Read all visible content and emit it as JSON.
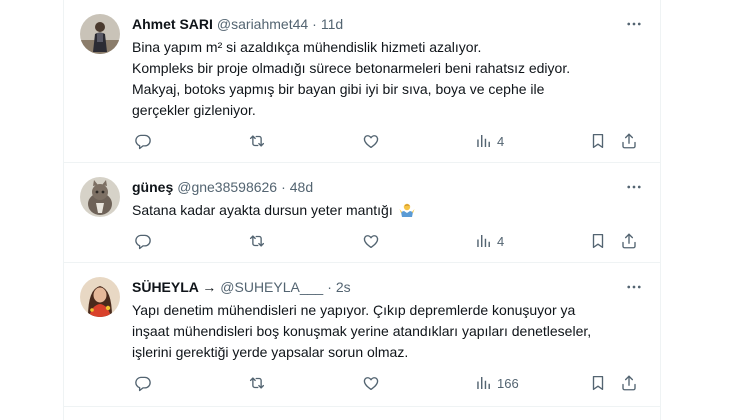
{
  "tweets": [
    {
      "display_name": "Ahmet SARI",
      "handle": "@sariahmet44",
      "separator": "·",
      "time": "11d",
      "lines": [
        "Bina yapım m² si azaldıkça mühendislik hizmeti azalıyor.",
        "Kompleks bir proje olmadığı sürece betonarmeleri beni rahatsız ediyor.",
        "Makyaj, botoks yapmış bir bayan gibi iyi bir sıva, boya ve cephe ile",
        "gerçekler gizleniyor."
      ],
      "views": "4"
    },
    {
      "display_name": "güneş",
      "handle": "@gne38598626",
      "separator": "·",
      "time": "48d",
      "lines": [
        "Satana kadar ayakta dursun yeter mantığı"
      ],
      "views": "4"
    },
    {
      "display_name": "SÜHEYLA →",
      "handle": "@SUHEYLA___",
      "separator": "·",
      "time": "2s",
      "lines": [
        "Yapı denetim mühendisleri ne yapıyor. Çıkıp depremlerde konuşuyor ya",
        "inşaat mühendisleri boş konuşmak yerine atandıkları yapıları denetleseler,",
        "işlerini gerektiği yerde yapsalar sorun olmaz."
      ],
      "views": "166"
    }
  ],
  "colors": {
    "text": "#0f1419",
    "muted": "#536471",
    "border": "#eff3f4"
  },
  "icons": [
    "reply-icon",
    "retweet-icon",
    "like-icon",
    "views-icon",
    "bookmark-icon",
    "share-icon",
    "more-icon",
    "shrug-emoji"
  ]
}
